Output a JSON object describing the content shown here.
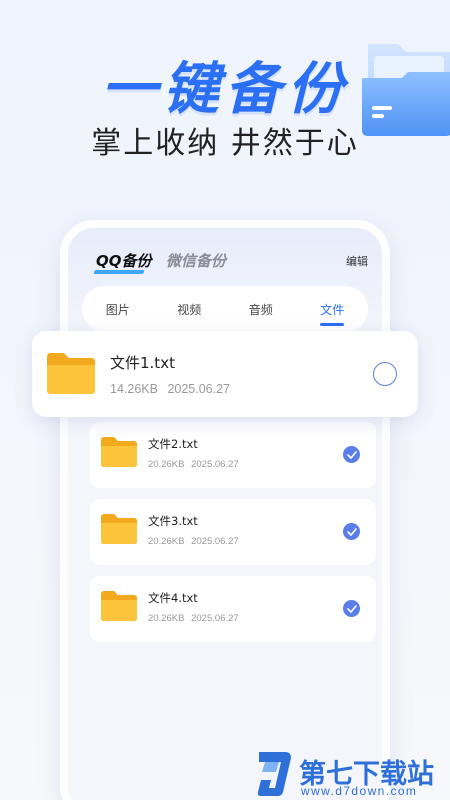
{
  "hero": {
    "title": "一键备份",
    "subtitle": "掌上收纳 井然于心"
  },
  "header": {
    "tabs": [
      {
        "label": "QQ备份",
        "active": true
      },
      {
        "label": "微信备份",
        "active": false
      }
    ],
    "edit_label": "编辑"
  },
  "segment": {
    "items": [
      {
        "label": "图片",
        "active": false
      },
      {
        "label": "视频",
        "active": false
      },
      {
        "label": "音频",
        "active": false
      },
      {
        "label": "文件",
        "active": true
      }
    ]
  },
  "files": [
    {
      "name": "文件1.txt",
      "size": "14.26KB",
      "date": "2025.06.27",
      "selected": false
    },
    {
      "name": "文件2.txt",
      "size": "20.26KB",
      "date": "2025.06.27",
      "selected": true
    },
    {
      "name": "文件3.txt",
      "size": "20.26KB",
      "date": "2025.06.27",
      "selected": true
    },
    {
      "name": "文件4.txt",
      "size": "20.26KB",
      "date": "2025.06.27",
      "selected": true
    }
  ],
  "watermark": {
    "brand": "第七下载站",
    "url": "www.d7down.com"
  },
  "colors": {
    "accent": "#2b6ff5",
    "check": "#5b7ee8",
    "folder": "#fbc43a"
  },
  "icons": {
    "folder": "folder-icon",
    "check": "check-circle-icon",
    "radio": "radio-empty-icon",
    "hero_decoration": "folder-decoration-icon"
  }
}
